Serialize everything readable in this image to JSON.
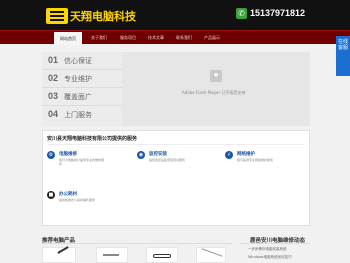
{
  "header": {
    "brand": "天翔电脑科技",
    "phone": "15137971812"
  },
  "nav": {
    "items": [
      "网站首页",
      "关于我们",
      "服务项目",
      "技术文章",
      "联系我们",
      "产品展示"
    ],
    "active_index": 0
  },
  "side_tab": {
    "label": "在线客服"
  },
  "banner": {
    "menu": [
      {
        "num": "01",
        "label": "信心保证"
      },
      {
        "num": "02",
        "label": "专业维护"
      },
      {
        "num": "03",
        "label": "覆盖面广"
      },
      {
        "num": "04",
        "label": "上门服务"
      }
    ],
    "flash_text": "Adobe Flash Player 已不再受支持"
  },
  "services": {
    "title": "安川县天翔电脑科技有限公司提供的服务",
    "items": [
      {
        "title": "电脑维修",
        "desc": "我们为电脑用户提供专业的维修服务",
        "icon": "wrench-icon",
        "color": "#1b56a8"
      },
      {
        "title": "监控安装",
        "desc": "提供监控设备安装调试服务",
        "icon": "camera-icon",
        "color": "#1b56a8"
      },
      {
        "title": "网络维护",
        "desc": "我们提供专业网络维护服务",
        "icon": "network-icon",
        "color": "#1b56a8"
      },
      {
        "title": "办公耗材",
        "desc": "提供各类办公耗材销售服务",
        "icon": "box-icon",
        "color": "#222222"
      }
    ]
  },
  "bottom": {
    "products_title": "推荐电脑产品",
    "news_title": "鹿邑安川电脑维修动态",
    "news_items": [
      "一步步教你电脑安装系统",
      "Windows电脑系统优化技巧"
    ]
  },
  "colors": {
    "header_bg": "#111111",
    "brand_yellow": "#ffd400",
    "nav_red": "#6e0000",
    "accent_blue": "#1a6fd0"
  }
}
